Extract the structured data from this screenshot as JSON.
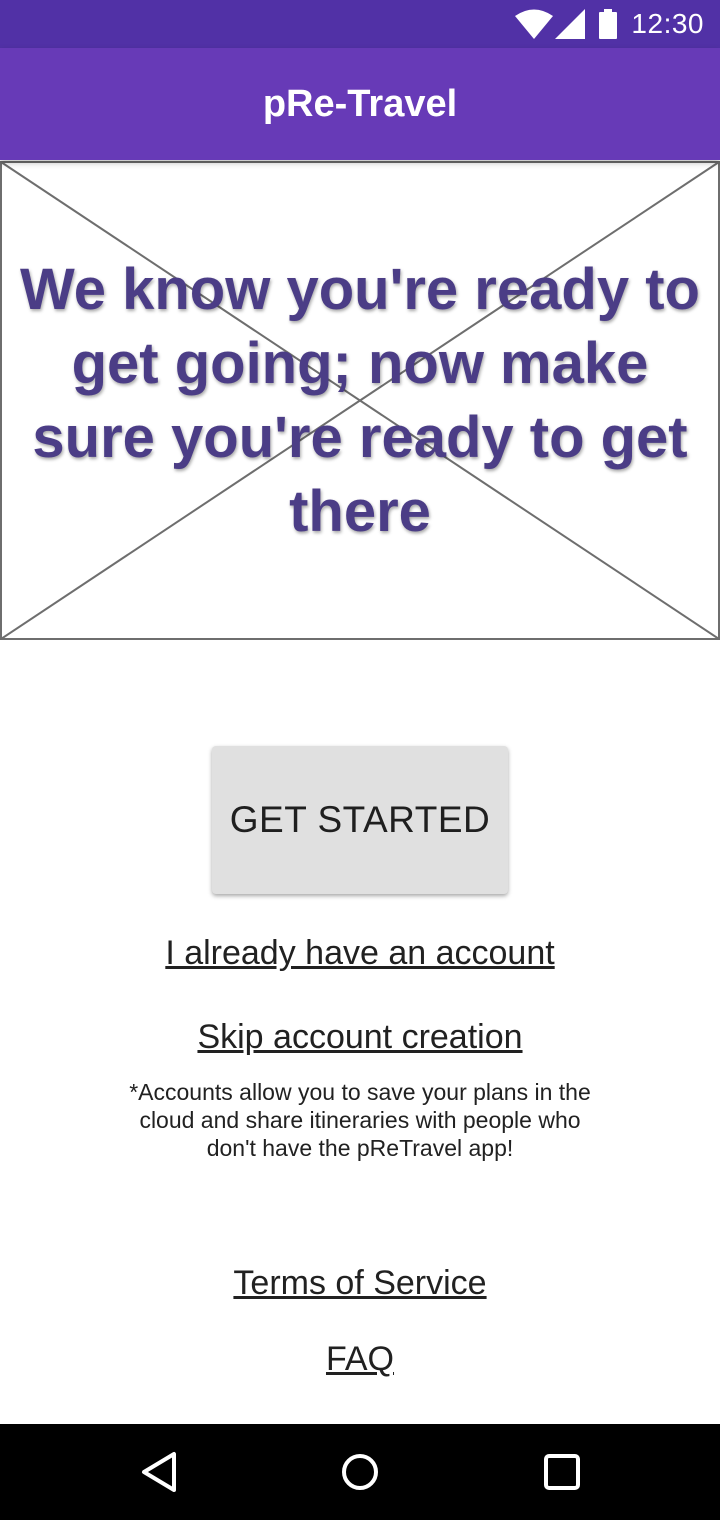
{
  "status_bar": {
    "time": "12:30",
    "icons": [
      "wifi-icon",
      "signal-icon",
      "battery-icon"
    ],
    "color": "#5131a6"
  },
  "app_bar": {
    "title": "pRe-Travel",
    "color": "#673ab7"
  },
  "hero": {
    "text": "We know you're ready to get going; now make sure you're ready to get there",
    "text_color": "#4b3d86"
  },
  "actions": {
    "get_started": "GET STARTED",
    "login": "I already have an account",
    "skip": "Skip account creation",
    "note": "*Accounts allow you to save your plans in the cloud and share itineraries with people who don't have the pReTravel app!",
    "terms": "Terms of Service",
    "faq": "FAQ"
  },
  "nav_bar": {
    "icons": [
      "back-icon",
      "home-icon",
      "recents-icon"
    ]
  }
}
